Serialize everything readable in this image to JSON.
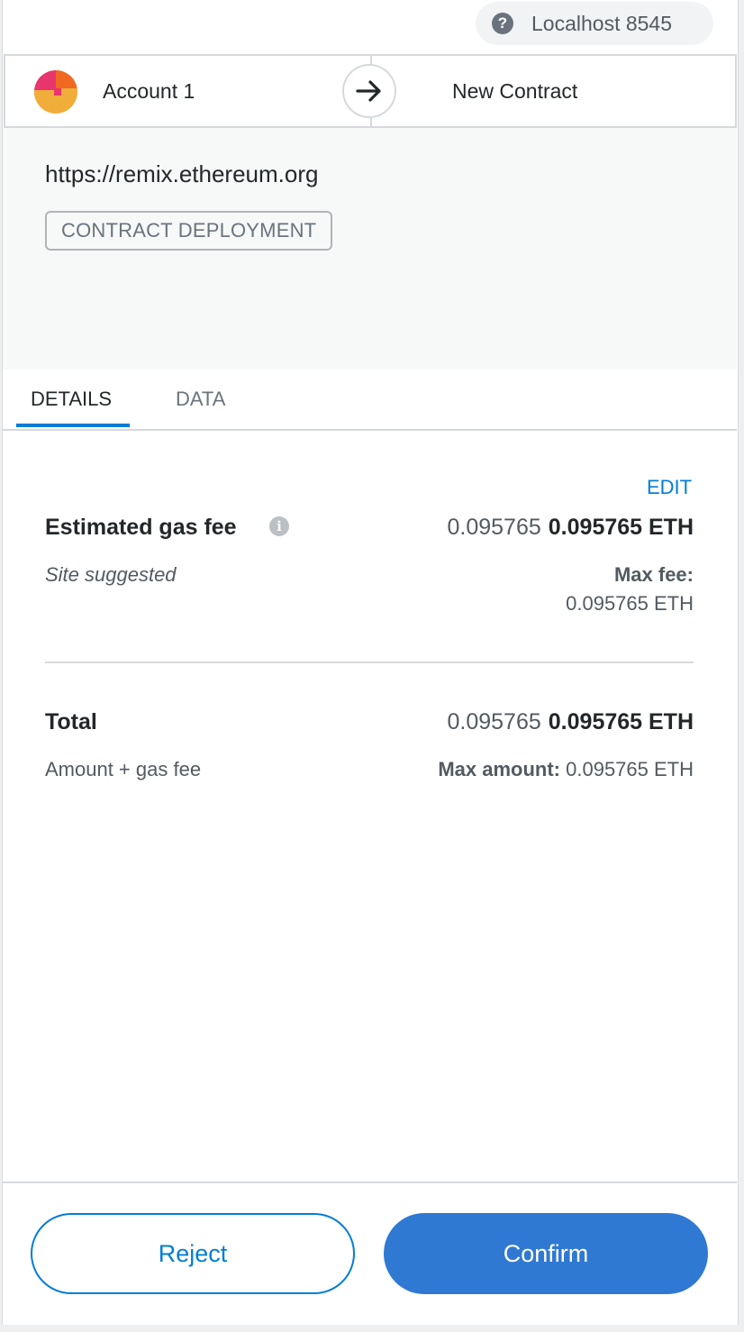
{
  "network": {
    "icon": "question-circle-icon",
    "label": "Localhost 8545"
  },
  "sender": {
    "name": "Account 1",
    "avatar": "jazzicon-avatar"
  },
  "direction_icon": "arrow-right-icon",
  "recipient": {
    "name": "New Contract"
  },
  "origin": {
    "url": "https://remix.ethereum.org",
    "badge": "CONTRACT DEPLOYMENT"
  },
  "tabs": [
    {
      "label": "DETAILS",
      "active": true
    },
    {
      "label": "DATA",
      "active": false
    }
  ],
  "details": {
    "edit_label": "EDIT",
    "gas": {
      "label": "Estimated gas fee",
      "info_icon": "info-icon",
      "secondary_value": "0.095765",
      "primary_value": "0.095765 ETH",
      "sub_label": "Site suggested",
      "max_fee_label": "Max fee:",
      "max_fee_value": "0.095765 ETH"
    },
    "total": {
      "label": "Total",
      "secondary_value": "0.095765",
      "primary_value": "0.095765 ETH",
      "sub_label": "Amount + gas fee",
      "max_amount_label": "Max amount:",
      "max_amount_value": "0.095765 ETH"
    }
  },
  "footer": {
    "reject_label": "Reject",
    "confirm_label": "Confirm"
  },
  "colors": {
    "accent": "#037dd6",
    "confirm_bg": "#3079d3",
    "text": "#24272a",
    "muted": "#535a61"
  }
}
